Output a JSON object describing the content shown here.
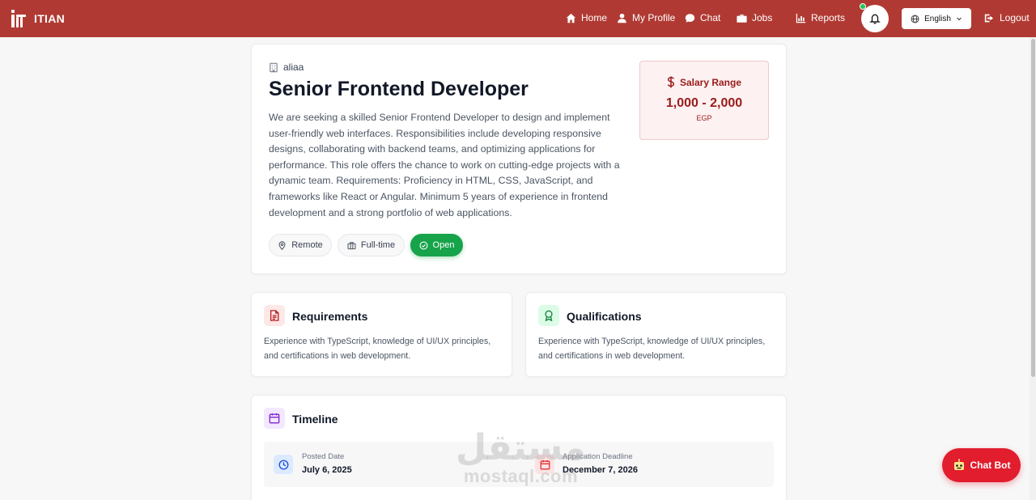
{
  "nav": {
    "brand": "ITIAN",
    "links": [
      "Home",
      "My Profile",
      "Chat",
      "Jobs",
      "Reports"
    ],
    "language": "English",
    "logout": "Logout"
  },
  "job": {
    "company": "aliaa",
    "title": "Senior Frontend Developer",
    "description": "We are seeking a skilled Senior Frontend Developer to design and implement user-friendly web interfaces. Responsibilities include developing responsive designs, collaborating with backend teams, and optimizing applications for performance. This role offers the chance to work on cutting-edge projects with a dynamic team. Requirements: Proficiency in HTML, CSS, JavaScript, and frameworks like React or Angular. Minimum 5 years of experience in frontend development and a strong portfolio of web applications.",
    "tags": {
      "location": "Remote",
      "type": "Full-time",
      "status": "Open"
    }
  },
  "salary": {
    "label": "Salary Range",
    "amount": "1,000 - 2,000",
    "currency": "EGP"
  },
  "requirements": {
    "title": "Requirements",
    "text": "Experience with TypeScript, knowledge of UI/UX principles, and certifications in web development."
  },
  "qualifications": {
    "title": "Qualifications",
    "text": "Experience with TypeScript, knowledge of UI/UX principles, and certifications in web development."
  },
  "timeline": {
    "title": "Timeline",
    "posted_label": "Posted Date",
    "posted_value": "July 6, 2025",
    "deadline_label": "Application Deadline",
    "deadline_value": "December 7, 2026"
  },
  "watermark": {
    "arabic": "مستقل",
    "latin": "mostaql.com"
  },
  "chatbot": {
    "label": "Chat Bot"
  },
  "colors": {
    "navbar": "#b03a33",
    "open": "#16a34a",
    "salary_text": "#991b1b",
    "chatbot": "#e11d2e"
  }
}
